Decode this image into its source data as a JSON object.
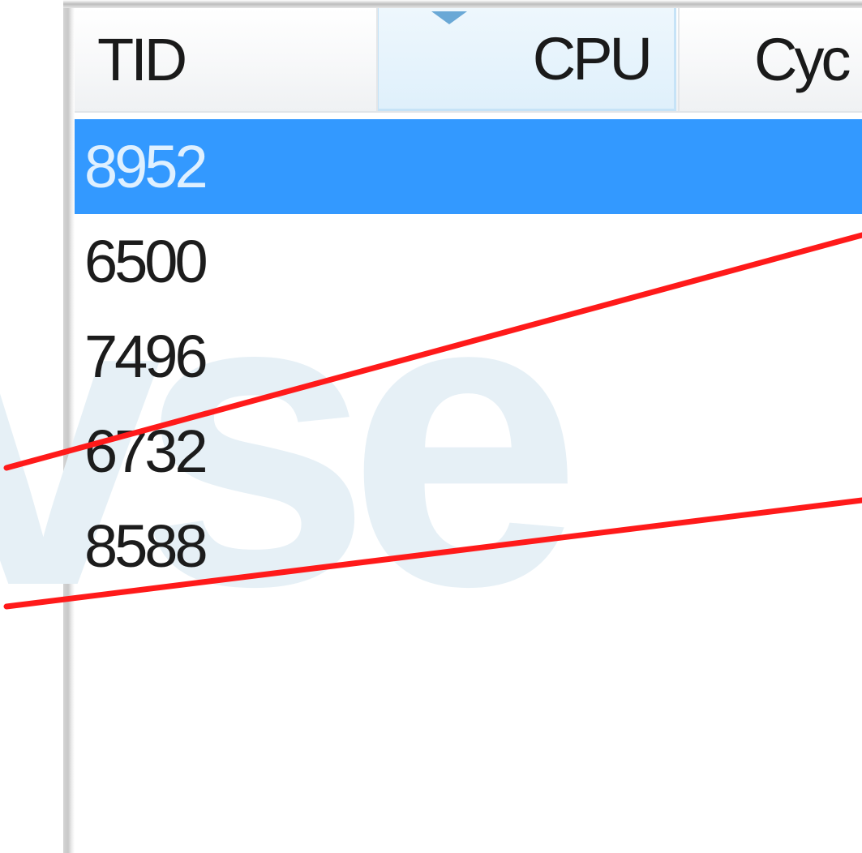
{
  "table": {
    "columns": [
      {
        "label": "TID"
      },
      {
        "label": "CPU",
        "sorted": "descending"
      },
      {
        "label": "Cyc"
      }
    ],
    "rows": [
      {
        "tid": "8952",
        "selected": true
      },
      {
        "tid": "6500",
        "selected": false
      },
      {
        "tid": "7496",
        "selected": false
      },
      {
        "tid": "6732",
        "selected": false
      },
      {
        "tid": "8588",
        "selected": false
      }
    ]
  },
  "colors": {
    "selection": "#3399ff",
    "sorted_header": "#dff0fb",
    "annotation_line": "#ff0000",
    "watermark": "#e6f0f6"
  }
}
